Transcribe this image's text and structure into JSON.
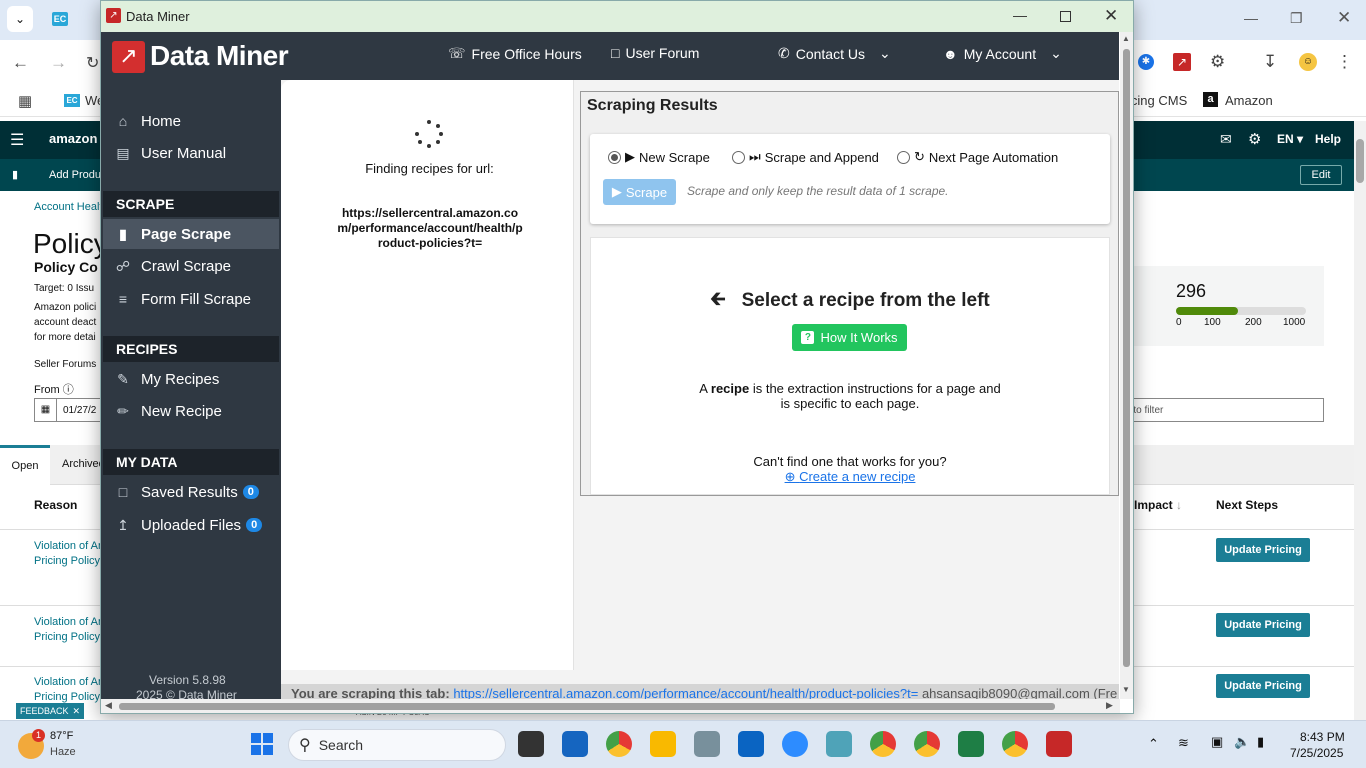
{
  "chrome": {
    "bookmark_1": "We",
    "bookmark_2": "icing CMS",
    "bookmark_3": "Amazon"
  },
  "amazon": {
    "logo": "amazon s",
    "nav_lang": "EN",
    "nav_help": "Help",
    "sub_add": "Add Produc",
    "sub_edit": "Edit",
    "breadcrumb": "Account Healt",
    "page_title": "Policy",
    "section_title": "Policy Co",
    "target": "Target: 0 Issu",
    "desc_1": "Amazon polici",
    "desc_2": "account deact",
    "desc_3": "for more detai",
    "forums": "Seller Forums",
    "from_label": "From",
    "date_value": "01/27/2",
    "filter_placeholder": "g to filter",
    "score": "296",
    "scale": [
      "0",
      "100",
      "200",
      "1000"
    ],
    "score_fraction": 0.296,
    "tabs": [
      "Open",
      "Archived"
    ],
    "col_reason": "Reason",
    "col_impact": "Impact",
    "col_next": "Next Steps",
    "rows": [
      {
        "line1": "Violation of An",
        "line2": "Pricing Policy",
        "action": "Update Pricing"
      },
      {
        "line1": "Violation of An",
        "line2": "Pricing Policy",
        "action": "Update Pricing"
      },
      {
        "line1": "Violation of An",
        "line2": "Pricing Policy",
        "action": "Update Pricing"
      }
    ],
    "asin_fragment": "ASIN B0 MP PC0AC",
    "feedback": "FEEDBACK"
  },
  "dataminer": {
    "window_title": "Data Miner",
    "brand": "Data Miner",
    "header": {
      "office_hours": "Free Office Hours",
      "forum": "User Forum",
      "contact": "Contact Us",
      "account": "My Account"
    },
    "sidebar": {
      "home": "Home",
      "manual": "User Manual",
      "scrape_section": "SCRAPE",
      "page_scrape": "Page Scrape",
      "crawl_scrape": "Crawl Scrape",
      "form_fill": "Form Fill Scrape",
      "recipes_section": "RECIPES",
      "my_recipes": "My Recipes",
      "new_recipe": "New Recipe",
      "data_section": "MY DATA",
      "saved_results": "Saved Results",
      "saved_count": "0",
      "uploaded_files": "Uploaded Files",
      "uploaded_count": "0",
      "version": "Version 5.8.98",
      "copyright": "2025 © Data Miner"
    },
    "finding": {
      "label": "Finding recipes for url:",
      "url": "https://sellercentral.amazon.com/performance/account/health/product-policies?t="
    },
    "results": {
      "title": "Scraping Results",
      "options": [
        "New Scrape",
        "Scrape and Append",
        "Next Page Automation"
      ],
      "selected": "New Scrape",
      "scrape_btn": "Scrape",
      "scrape_hint": "Scrape and only keep the result data of 1 scrape.",
      "select_title": "Select a recipe from the left",
      "how_it_works": "How It Works",
      "recipe_pre": "A",
      "recipe_word": "recipe",
      "recipe_rest": "is the extraction instructions for a page and",
      "recipe_line2": "is specific to each page.",
      "cant_find": "Can't find one that works for you?",
      "create_link": "Create a new recipe"
    },
    "footer": {
      "label": "You are scraping this tab:",
      "url": "https://sellercentral.amazon.com/performance/account/health/product-policies?t=",
      "email": "ahsansaqib8090@gmail.com (Fre"
    }
  },
  "taskbar": {
    "temp": "87°F",
    "weather": "Haze",
    "weather_badge": "1",
    "search": "Search",
    "time": "8:43 PM",
    "date": "7/25/2025"
  }
}
